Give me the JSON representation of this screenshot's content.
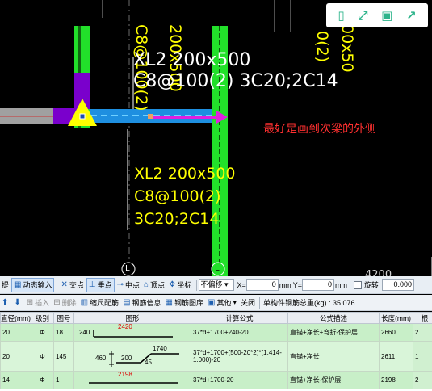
{
  "canvas": {
    "beam_label_top": {
      "line1": "XL2 200x500",
      "line2": "C8@100(2) 3C20;2C14"
    },
    "beam_label_bottom": {
      "line1": "XL2 200x500",
      "line2": "C8@100(2)",
      "line3": "3C20;2C14"
    },
    "vertical_label_left": "C8@100(2)",
    "vertical_label_right": "200x500",
    "vertical_label_far_right_a": "0(2)",
    "vertical_label_far_right_b": "00x50",
    "note": "最好是画到次梁的外侧",
    "axis_marker": "L",
    "axis_marker_2": "L",
    "dimension": "4200",
    "colors": {
      "green": "#22e02a",
      "blue": "#1e8fe0",
      "magenta": "#e020e0",
      "purple": "#7a00cc",
      "yellow": "#ffff00",
      "red_text": "#ff3030"
    }
  },
  "float_toolbar": {
    "icons": [
      "phone-icon",
      "expand-icon",
      "save-icon",
      "share-icon"
    ],
    "glyphs": [
      "▯",
      "⤢",
      "▣",
      "↗"
    ]
  },
  "snapbar": {
    "items": [
      "提",
      "动态输入",
      "交点",
      "垂点",
      "中点",
      "顶点",
      "坐标"
    ],
    "offset_mode": "不偏移",
    "x_label": "X=",
    "x_value": "0",
    "unit_mm": "mm",
    "y_label": "Y=",
    "y_value": "0",
    "unit_mm2": "mm",
    "rotate_label": "旋转",
    "rotate_value": "0.000"
  },
  "rebar_toolbar": {
    "items": [
      "插入",
      "删除",
      "缩尺配筋",
      "钢筋信息",
      "钢筋图库",
      "其他",
      "关闭"
    ],
    "total_label": "单构件钢筋总重(kg) : 35.076"
  },
  "table": {
    "headers": [
      "直径(mm)",
      "级别",
      "图号",
      "图形",
      "计算公式",
      "公式描述",
      "长度(mm)",
      "根"
    ],
    "rows": [
      {
        "diameter": "20",
        "grade": "Φ",
        "shape_no": "18",
        "shape_left": "240",
        "shape_top": "2420",
        "formula": "37*d+1700+240-20",
        "desc": "直锚+净长+弯折-保护层",
        "length": "2660",
        "count": "2"
      },
      {
        "diameter": "20",
        "grade": "Φ",
        "shape_no": "145",
        "shape_a": "460",
        "shape_b": "200",
        "shape_c": "1740",
        "shape_d": "45",
        "formula": "37*d+1700+(500-20*2)*(1.414-1.000)-20",
        "desc": "直锚+净长",
        "length": "2611",
        "count": "1"
      },
      {
        "diameter": "14",
        "grade": "Φ",
        "shape_no": "1",
        "shape_top": "2198",
        "formula": "37*d+1700-20",
        "desc": "直锚+净长-保护层",
        "length": "2198",
        "count": "2"
      }
    ]
  }
}
